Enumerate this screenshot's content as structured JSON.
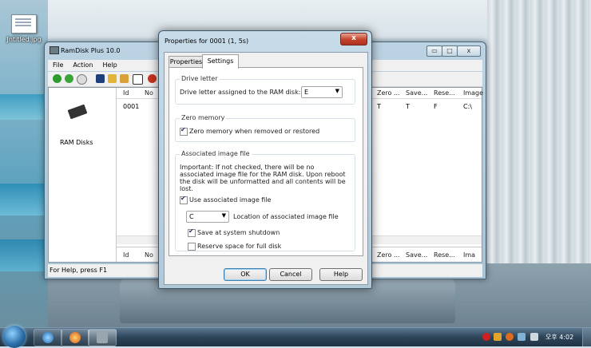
{
  "desktop": {
    "icon_label": "Jntitled.jpg"
  },
  "main_window": {
    "title": "RamDisk Plus 10.0",
    "caption_buttons": {
      "minimize": "▭",
      "maximize": "□",
      "close": "x"
    },
    "menu": [
      "File",
      "Action",
      "Help"
    ],
    "left_pane_label": "RAM Disks",
    "columns_left": [
      "Id",
      "No"
    ],
    "columns_right": [
      "Zero ...",
      "Save...",
      "Rese...",
      "Image"
    ],
    "row": {
      "id": "0001",
      "zero": "T",
      "save": "T",
      "reserve": "F",
      "image": "C:\\"
    },
    "footer_columns_left": [
      "Id",
      "No"
    ],
    "footer_columns_right": [
      "Zero ...",
      "Save...",
      "Rese...",
      "Ima"
    ],
    "status": "For Help, press F1"
  },
  "dialog": {
    "title": "Properties for 0001 (1, 5s)",
    "close_label": "x",
    "tabs": [
      "Properties",
      "Settings"
    ],
    "drive_letter": {
      "group_title": "Drive letter",
      "label": "Drive letter assigned to the RAM disk:",
      "value": "E"
    },
    "zero_memory": {
      "group_title": "Zero memory",
      "checkbox_label": "Zero memory when removed or restored",
      "checked": true
    },
    "associated_image": {
      "group_title": "Associated image file",
      "description": "Important: If not checked, there will be no associated image file for the RAM disk. Upon reboot the disk will be unformatted and all contents will be lost.",
      "use_label": "Use associated image file",
      "use_checked": true,
      "location_value": "C",
      "location_label": "Location of associated image file",
      "save_label": "Save at system shutdown",
      "save_checked": true,
      "reserve_label": "Reserve space for full disk",
      "reserve_checked": false
    },
    "buttons": {
      "ok": "OK",
      "cancel": "Cancel",
      "help": "Help"
    }
  },
  "taskbar": {
    "clock": "오후 4:02"
  }
}
